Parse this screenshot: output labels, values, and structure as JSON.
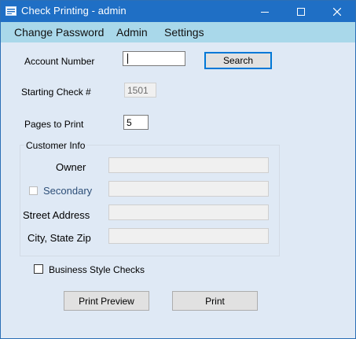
{
  "window": {
    "title": "Check Printing - admin",
    "accent_color": "#1f6fc5",
    "menu_color": "#a9d8ea",
    "background_color": "#dfe9f5"
  },
  "menu": {
    "items": [
      {
        "label": "Change Password"
      },
      {
        "label": "Admin"
      },
      {
        "label": "Settings"
      }
    ]
  },
  "form": {
    "account_number": {
      "label": "Account Number",
      "value": ""
    },
    "search_label": "Search",
    "starting_check": {
      "label": "Starting Check #",
      "value": "1501"
    },
    "pages_to_print": {
      "label": "Pages to Print",
      "value": "5"
    }
  },
  "customer_info": {
    "title": "Customer Info",
    "owner": {
      "label": "Owner",
      "value": ""
    },
    "secondary": {
      "label": "Secondary",
      "value": "",
      "checked": false
    },
    "street_address": {
      "label": "Street Address",
      "value": ""
    },
    "city_state_zip": {
      "label": "City, State Zip",
      "value": ""
    }
  },
  "business_style": {
    "label": "Business Style Checks",
    "checked": false
  },
  "actions": {
    "print_preview_label": "Print Preview",
    "print_label": "Print"
  },
  "icons": [
    "app-icon",
    "minimize-icon",
    "maximize-icon",
    "close-icon"
  ]
}
